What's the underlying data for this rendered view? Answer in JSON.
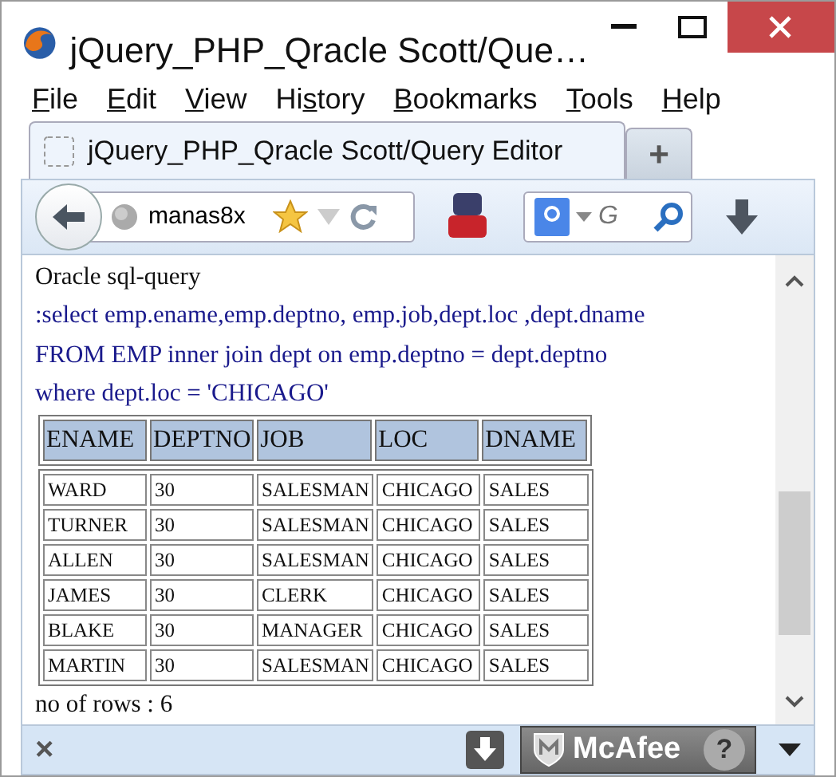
{
  "window": {
    "title": "jQuery_PHP_Qracle Scott/Que…"
  },
  "menu": [
    {
      "access_key": "F",
      "after_key": "ile"
    },
    {
      "access_key": "E",
      "after_key": "dit"
    },
    {
      "access_key": "V",
      "after_key": "iew"
    },
    {
      "before_key": "Hi",
      "access_key": "s",
      "after_key": "tory"
    },
    {
      "access_key": "B",
      "after_key": "ookmarks"
    },
    {
      "access_key": "T",
      "after_key": "ools"
    },
    {
      "access_key": "H",
      "after_key": "elp"
    }
  ],
  "tabs": [
    {
      "title": "jQuery_PHP_Qracle Scott/Query Editor",
      "selected": true
    }
  ],
  "new_tab": "+",
  "address": {
    "value": "manas8x"
  },
  "search": {
    "placeholder": "G"
  },
  "content": {
    "heading": "Oracle sql-query",
    "query_lines": [
      ":select emp.ename,emp.deptno, emp.job,dept.loc ,dept.dname",
      "FROM EMP inner join dept on emp.deptno = dept.deptno",
      "where dept.loc = 'CHICAGO'"
    ],
    "table": {
      "columns": [
        "ENAME",
        "DEPTNO",
        "JOB",
        "LOC",
        "DNAME"
      ],
      "rows": [
        [
          "WARD",
          "30",
          "SALESMAN",
          "CHICAGO",
          "SALES"
        ],
        [
          "TURNER",
          "30",
          "SALESMAN",
          "CHICAGO",
          "SALES"
        ],
        [
          "ALLEN",
          "30",
          "SALESMAN",
          "CHICAGO",
          "SALES"
        ],
        [
          "JAMES",
          "30",
          "CLERK",
          "CHICAGO",
          "SALES"
        ],
        [
          "BLAKE",
          "30",
          "MANAGER",
          "CHICAGO",
          "SALES"
        ],
        [
          "MARTIN",
          "30",
          "SALESMAN",
          "CHICAGO",
          "SALES"
        ]
      ]
    },
    "footer": "no of rows : 6"
  },
  "addon_bar": {
    "close": "×",
    "badge": "McAfee",
    "help": "?"
  }
}
